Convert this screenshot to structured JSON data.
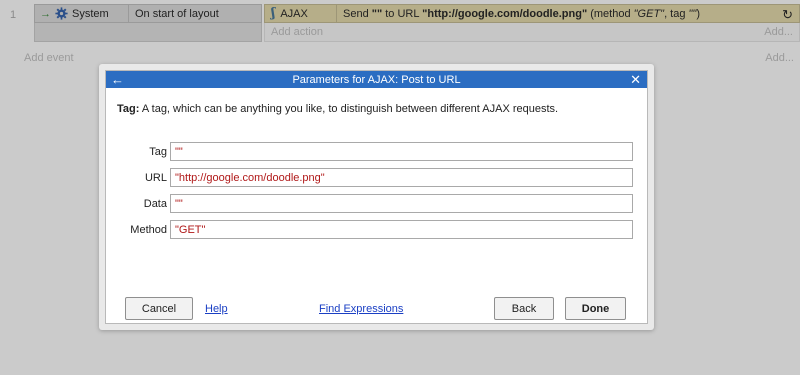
{
  "event_sheet": {
    "row_number": "1",
    "condition": {
      "object": "System",
      "text": "On start of layout"
    },
    "action": {
      "object": "AJAX",
      "text_prefix": "Send ",
      "text_tag_quote": "\"\"",
      "text_mid": " to URL ",
      "text_url": "\"http://google.com/doodle.png\"",
      "text_method_prefix": " (method ",
      "text_method": "\"GET\"",
      "text_tag_part": ", tag ",
      "text_tag_value": "\"\"",
      "text_close": ")"
    },
    "add_action": "Add action",
    "add_right_1": "Add...",
    "add_event": "Add event",
    "add_right_2": "Add..."
  },
  "dialog": {
    "title": "Parameters for AJAX: Post to URL",
    "hint_label": "Tag:",
    "hint_text": " A tag, which can be anything you like, to distinguish between different AJAX requests.",
    "fields": [
      {
        "label": "Tag",
        "value": "\"\""
      },
      {
        "label": "URL",
        "value": "\"http://google.com/doodle.png\""
      },
      {
        "label": "Data",
        "value": "\"\""
      },
      {
        "label": "Method",
        "value": "\"GET\""
      }
    ],
    "buttons": {
      "cancel": "Cancel",
      "help": "Help",
      "find_expressions": "Find Expressions",
      "back": "Back",
      "done": "Done"
    }
  },
  "colors": {
    "titlebar": "#2b6dc2",
    "value_text": "#b01818",
    "link": "#1a3fc4"
  }
}
